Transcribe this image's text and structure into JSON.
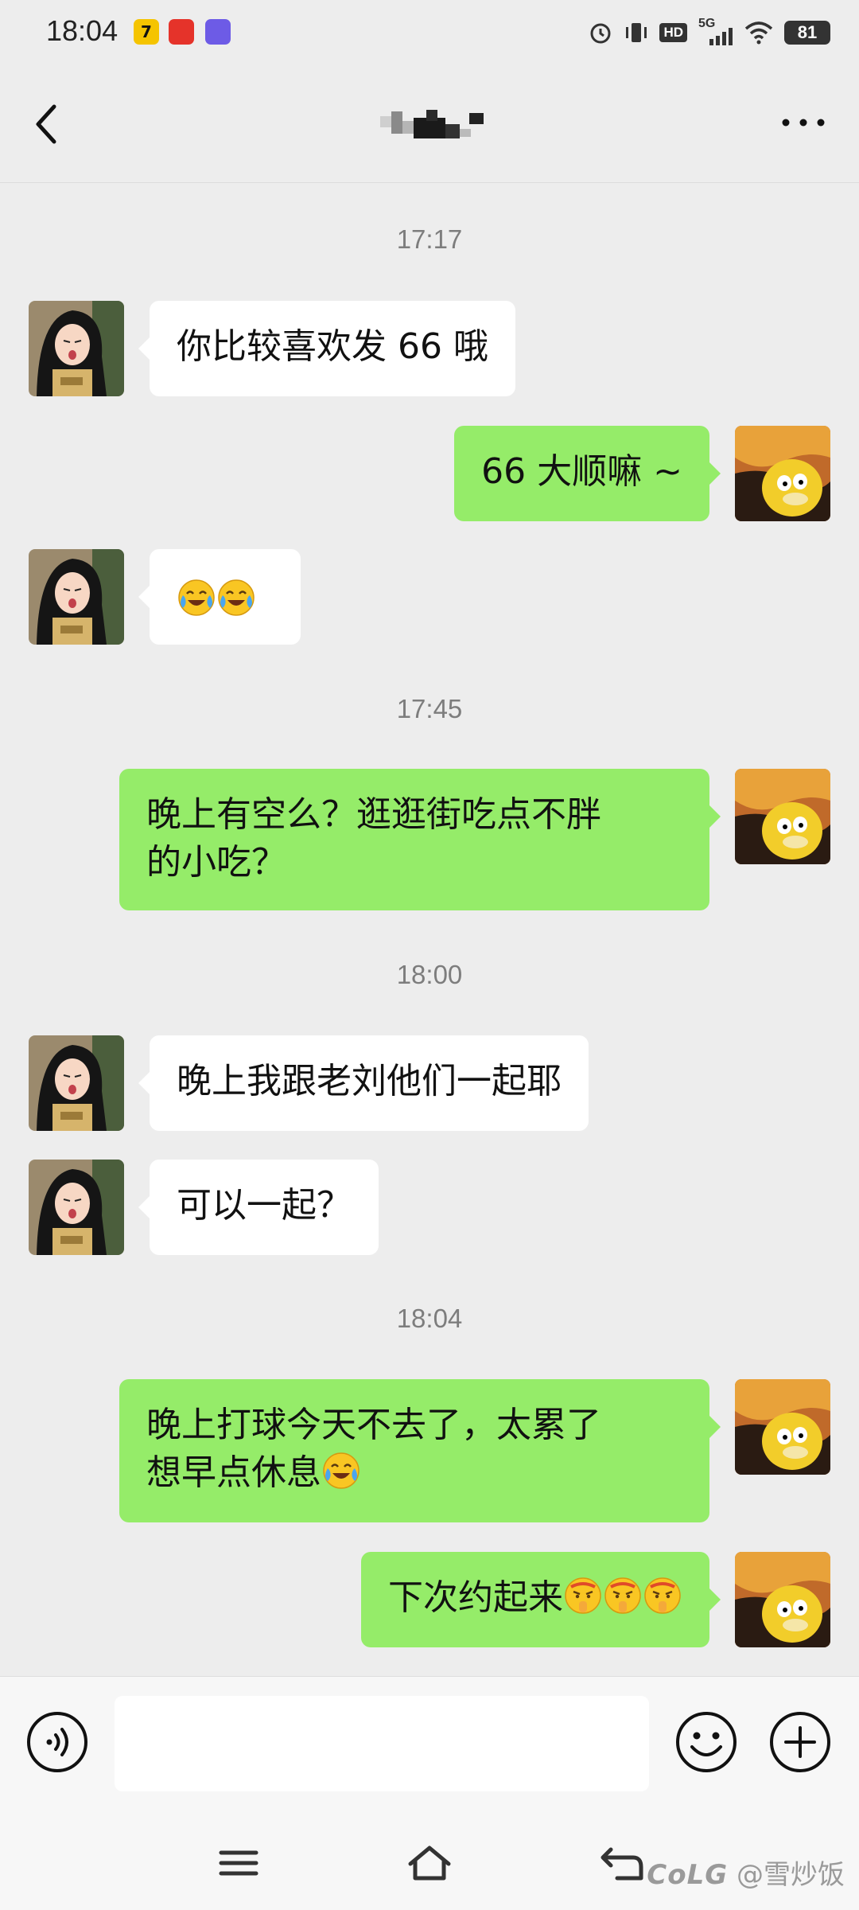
{
  "status_bar": {
    "time": "18:04",
    "network": "5G",
    "hd": "HD",
    "battery": "81",
    "apps": [
      {
        "name": "app-7",
        "label": "7",
        "color": "#f5c400"
      },
      {
        "name": "app-red",
        "label": "",
        "color": "#e5332a"
      },
      {
        "name": "app-purple",
        "label": "",
        "color": "#6d5be6"
      }
    ]
  },
  "header": {
    "title": "",
    "title_pixelated": true,
    "back_icon": "chevron-left-icon",
    "more_icon": "more-icon"
  },
  "messages": [
    {
      "type": "time",
      "text": "17:17"
    },
    {
      "type": "msg",
      "side": "left",
      "text": "你比较喜欢发 66 哦"
    },
    {
      "type": "msg",
      "side": "right",
      "text": "66 大顺嘛 ~"
    },
    {
      "type": "msg",
      "side": "left",
      "text": "",
      "emojis": [
        "face-with-tears-of-joy",
        "face-with-tears-of-joy"
      ]
    },
    {
      "type": "time",
      "text": "17:45"
    },
    {
      "type": "msg",
      "side": "right",
      "lines": [
        "晚上有空么？逛逛街吃点不胖",
        "的小吃？"
      ]
    },
    {
      "type": "time",
      "text": "18:00"
    },
    {
      "type": "msg",
      "side": "left",
      "text": "晚上我跟老刘他们一起耶"
    },
    {
      "type": "msg",
      "side": "left",
      "text": "可以一起？"
    },
    {
      "type": "time",
      "text": "18:04"
    },
    {
      "type": "msg",
      "side": "right",
      "lines": [
        "晚上打球今天不去了，太累了",
        "想早点休息"
      ],
      "emojis": [
        "face-with-tears-of-joy"
      ]
    },
    {
      "type": "msg",
      "side": "right",
      "text": "下次约起来",
      "emojis": [
        "shushing-face",
        "shushing-face",
        "shushing-face"
      ]
    }
  ],
  "input_bar": {
    "voice_icon": "voice-icon",
    "placeholder": "",
    "emoji_icon": "smiley-icon",
    "plus_icon": "plus-icon"
  },
  "system_nav": {
    "menu_icon": "menu-icon",
    "home_icon": "home-icon",
    "back_icon": "back-arrow-icon"
  },
  "watermark": {
    "logo": "CoLG",
    "text": "@雪炒饭"
  },
  "colors": {
    "background": "#ededed",
    "my_bubble": "#95ec69",
    "their_bubble": "#ffffff",
    "time_text": "#7d7d7d"
  }
}
